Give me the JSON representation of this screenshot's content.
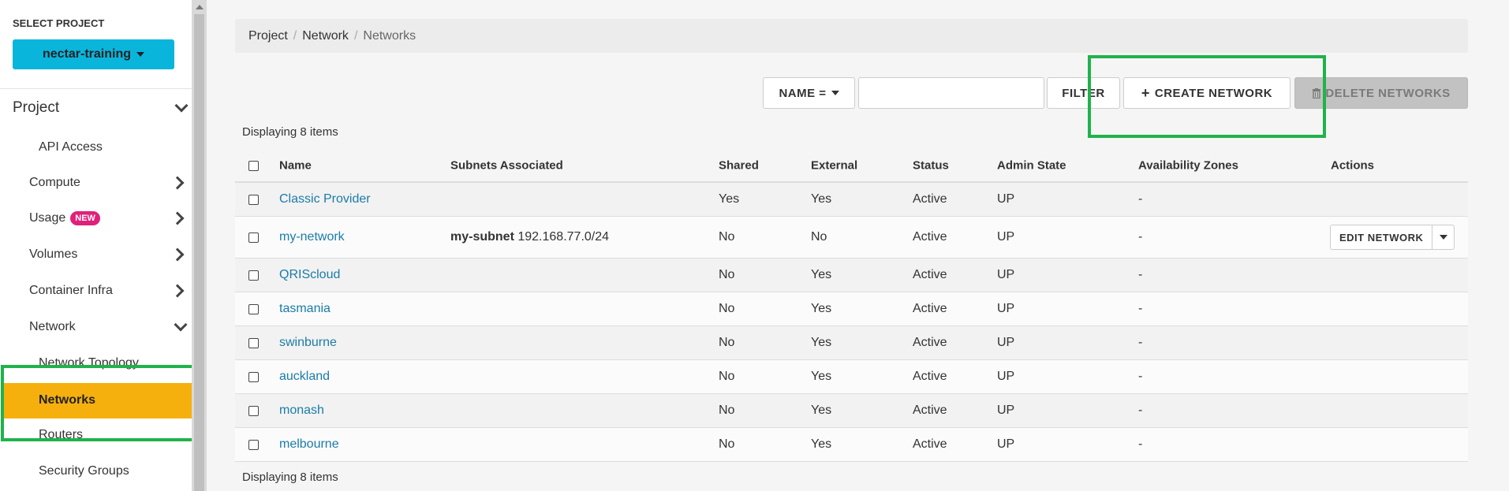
{
  "sidebar": {
    "select_project_title": "SELECT PROJECT",
    "project_name": "nectar-training",
    "section_title": "Project",
    "items": [
      {
        "label": "API Access",
        "has_chevron": false
      },
      {
        "label": "Compute",
        "has_chevron": true
      },
      {
        "label": "Usage",
        "badge": "NEW",
        "has_chevron": true
      },
      {
        "label": "Volumes",
        "has_chevron": true
      },
      {
        "label": "Container Infra",
        "has_chevron": true
      },
      {
        "label": "Network",
        "has_chevron": true,
        "expanded": true
      }
    ],
    "network_items": [
      {
        "label": "Network Topology"
      },
      {
        "label": "Networks",
        "active": true
      },
      {
        "label": "Routers"
      },
      {
        "label": "Security Groups"
      }
    ]
  },
  "breadcrumb": [
    "Project",
    "Network",
    "Networks"
  ],
  "toolbar": {
    "filter_field": "NAME =",
    "filter_value": "",
    "filter_label": "FILTER",
    "create_label": "CREATE NETWORK",
    "delete_label": "DELETE NETWORKS"
  },
  "display_count": "Displaying 8 items",
  "table": {
    "columns": [
      "Name",
      "Subnets Associated",
      "Shared",
      "External",
      "Status",
      "Admin State",
      "Availability Zones",
      "Actions"
    ],
    "rows": [
      {
        "name": "Classic Provider",
        "subnet_name": "",
        "subnet_cidr": "",
        "shared": "Yes",
        "external": "Yes",
        "status": "Active",
        "admin_state": "UP",
        "zones": "-",
        "action": ""
      },
      {
        "name": "my-network",
        "subnet_name": "my-subnet",
        "subnet_cidr": "192.168.77.0/24",
        "shared": "No",
        "external": "No",
        "status": "Active",
        "admin_state": "UP",
        "zones": "-",
        "action": "EDIT NETWORK"
      },
      {
        "name": "QRIScloud",
        "subnet_name": "",
        "subnet_cidr": "",
        "shared": "No",
        "external": "Yes",
        "status": "Active",
        "admin_state": "UP",
        "zones": "-",
        "action": ""
      },
      {
        "name": "tasmania",
        "subnet_name": "",
        "subnet_cidr": "",
        "shared": "No",
        "external": "Yes",
        "status": "Active",
        "admin_state": "UP",
        "zones": "-",
        "action": ""
      },
      {
        "name": "swinburne",
        "subnet_name": "",
        "subnet_cidr": "",
        "shared": "No",
        "external": "Yes",
        "status": "Active",
        "admin_state": "UP",
        "zones": "-",
        "action": ""
      },
      {
        "name": "auckland",
        "subnet_name": "",
        "subnet_cidr": "",
        "shared": "No",
        "external": "Yes",
        "status": "Active",
        "admin_state": "UP",
        "zones": "-",
        "action": ""
      },
      {
        "name": "monash",
        "subnet_name": "",
        "subnet_cidr": "",
        "shared": "No",
        "external": "Yes",
        "status": "Active",
        "admin_state": "UP",
        "zones": "-",
        "action": ""
      },
      {
        "name": "melbourne",
        "subnet_name": "",
        "subnet_cidr": "",
        "shared": "No",
        "external": "Yes",
        "status": "Active",
        "admin_state": "UP",
        "zones": "-",
        "action": ""
      }
    ]
  },
  "colors": {
    "project_button": "#0ab5dc",
    "active_nav": "#f6b00e",
    "highlight_box": "#1fb34b",
    "link": "#1a7ca8",
    "new_badge": "#e0217a"
  }
}
